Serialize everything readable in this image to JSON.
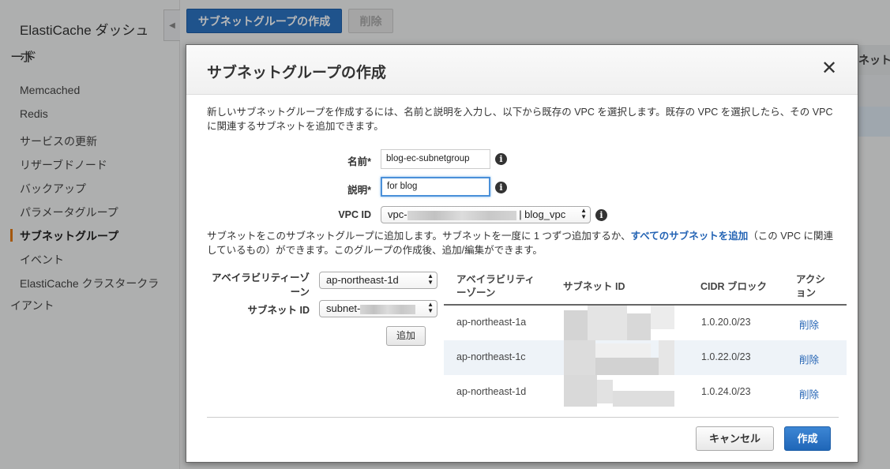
{
  "sidebar": {
    "title_line1": "ElastiCache ダッシュボ",
    "title_line2": "ード",
    "items": [
      {
        "label": "Memcached"
      },
      {
        "label": "Redis"
      },
      {
        "label": "サービスの更新"
      },
      {
        "label": "リザーブドノード"
      },
      {
        "label": "バックアップ"
      },
      {
        "label": "パラメータグループ"
      },
      {
        "label": "サブネットグループ"
      },
      {
        "label": "イベント"
      },
      {
        "label": "ElastiCache クラスタークラ",
        "label2": "イアント"
      }
    ]
  },
  "toolbar": {
    "create_label": "サブネットグループの作成",
    "delete_label": "削除"
  },
  "background_table": {
    "header_fragment": "ネット"
  },
  "modal": {
    "title": "サブネットグループの作成",
    "close_glyph": "✕",
    "intro": "新しいサブネットグループを作成するには、名前と説明を入力し、以下から既存の VPC を選択します。既存の VPC を選択したら、その VPC に関連するサブネットを追加できます。",
    "name_label": "名前*",
    "name_value": "blog-ec-subnetgroup",
    "desc_label": "説明*",
    "desc_value": "for blog",
    "vpc_label": "VPC ID",
    "vpc_prefix": "vpc-",
    "vpc_suffix": "| blog_vpc",
    "subnet_desc_before": "サブネットをこのサブネットグループに追加します。サブネットを一度に 1 つずつ追加するか、",
    "subnet_desc_link": "すべてのサブネットを追加",
    "subnet_desc_after": "（この VPC に関連しているもの）ができます。このグループの作成後、追加/編集ができます。",
    "az_label": "アベイラビリティーゾーン",
    "az_value": "ap-northeast-1d",
    "subnet_id_label": "サブネット ID",
    "subnet_id_prefix": "subnet-",
    "add_label": "追加",
    "table": {
      "headers": [
        "アベイラビリティーゾーン",
        "サブネット ID",
        "CIDR ブロック",
        "アクション"
      ],
      "rows": [
        {
          "az": "ap-northeast-1a",
          "cidr": "1.0.20.0/23",
          "action": "削除"
        },
        {
          "az": "ap-northeast-1c",
          "cidr": "1.0.22.0/23",
          "action": "削除"
        },
        {
          "az": "ap-northeast-1d",
          "cidr": "1.0.24.0/23",
          "action": "削除"
        }
      ]
    },
    "cancel_label": "キャンセル",
    "create_label": "作成"
  },
  "colors": {
    "primary": "#2b73c2",
    "link": "#2363b4",
    "active_marker": "#e47911"
  }
}
